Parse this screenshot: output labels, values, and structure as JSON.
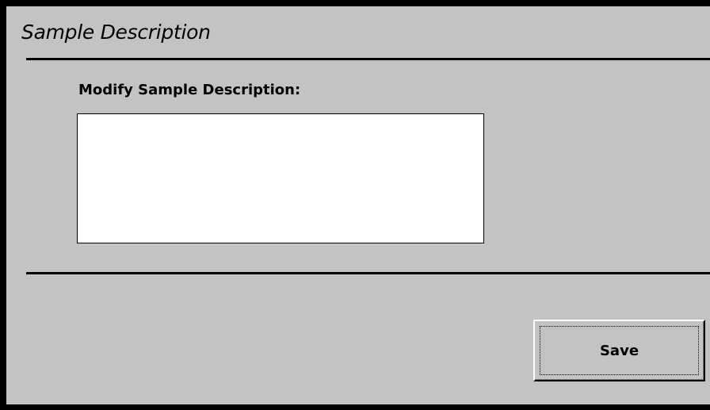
{
  "dialog": {
    "title": "Sample Description",
    "field_label": "Modify Sample Description:",
    "description_value": "",
    "save_label": "Save"
  }
}
